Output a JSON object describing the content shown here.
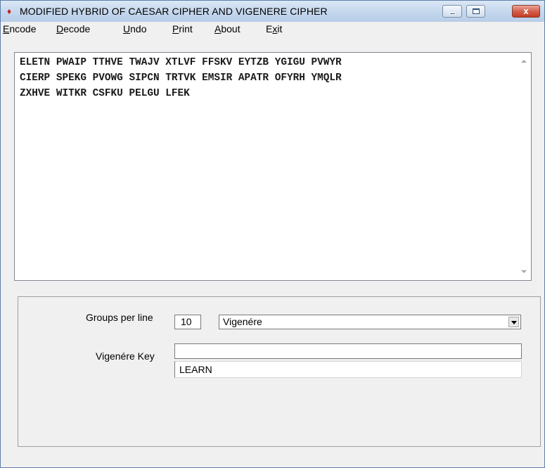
{
  "window": {
    "title": "MODIFIED HYBRID OF CAESAR CIPHER AND VIGENERE CIPHER",
    "close_label": "x"
  },
  "menu": {
    "encode": {
      "accel": "E",
      "rest": "ncode"
    },
    "decode": {
      "accel": "D",
      "rest": "ecode"
    },
    "undo": {
      "accel": "U",
      "rest": "ndo"
    },
    "print": {
      "accel": "P",
      "rest": "rint"
    },
    "about": {
      "accel": "A",
      "rest": "bout"
    },
    "exit": {
      "pre": "E",
      "accel": "x",
      "rest": "it"
    }
  },
  "ciphertext": {
    "lines": [
      "ELETN PWAIP TTHVE TWAJV XTLVF FFSKV EYTZB YGIGU PVWYR",
      "CIERP SPEKG PVOWG SIPCN TRTVK EMSIR APATR OFYRH YMQLR",
      "ZXHVE WITKR CSFKU PELGU LFEK"
    ]
  },
  "options": {
    "groups_label": "Groups per line",
    "groups_value": "10",
    "cipher_selected": "Vigenére",
    "key_label": "Vigenére Key",
    "key_value": "LEARN"
  },
  "colors": {
    "title_icon": "#cc1b1b",
    "close_button": "#c43c22"
  },
  "icons": {
    "app": "red-diamond-icon",
    "minimize": "minimize-icon",
    "maximize": "maximize-icon",
    "close": "close-icon",
    "dropdown": "chevron-down-icon"
  }
}
